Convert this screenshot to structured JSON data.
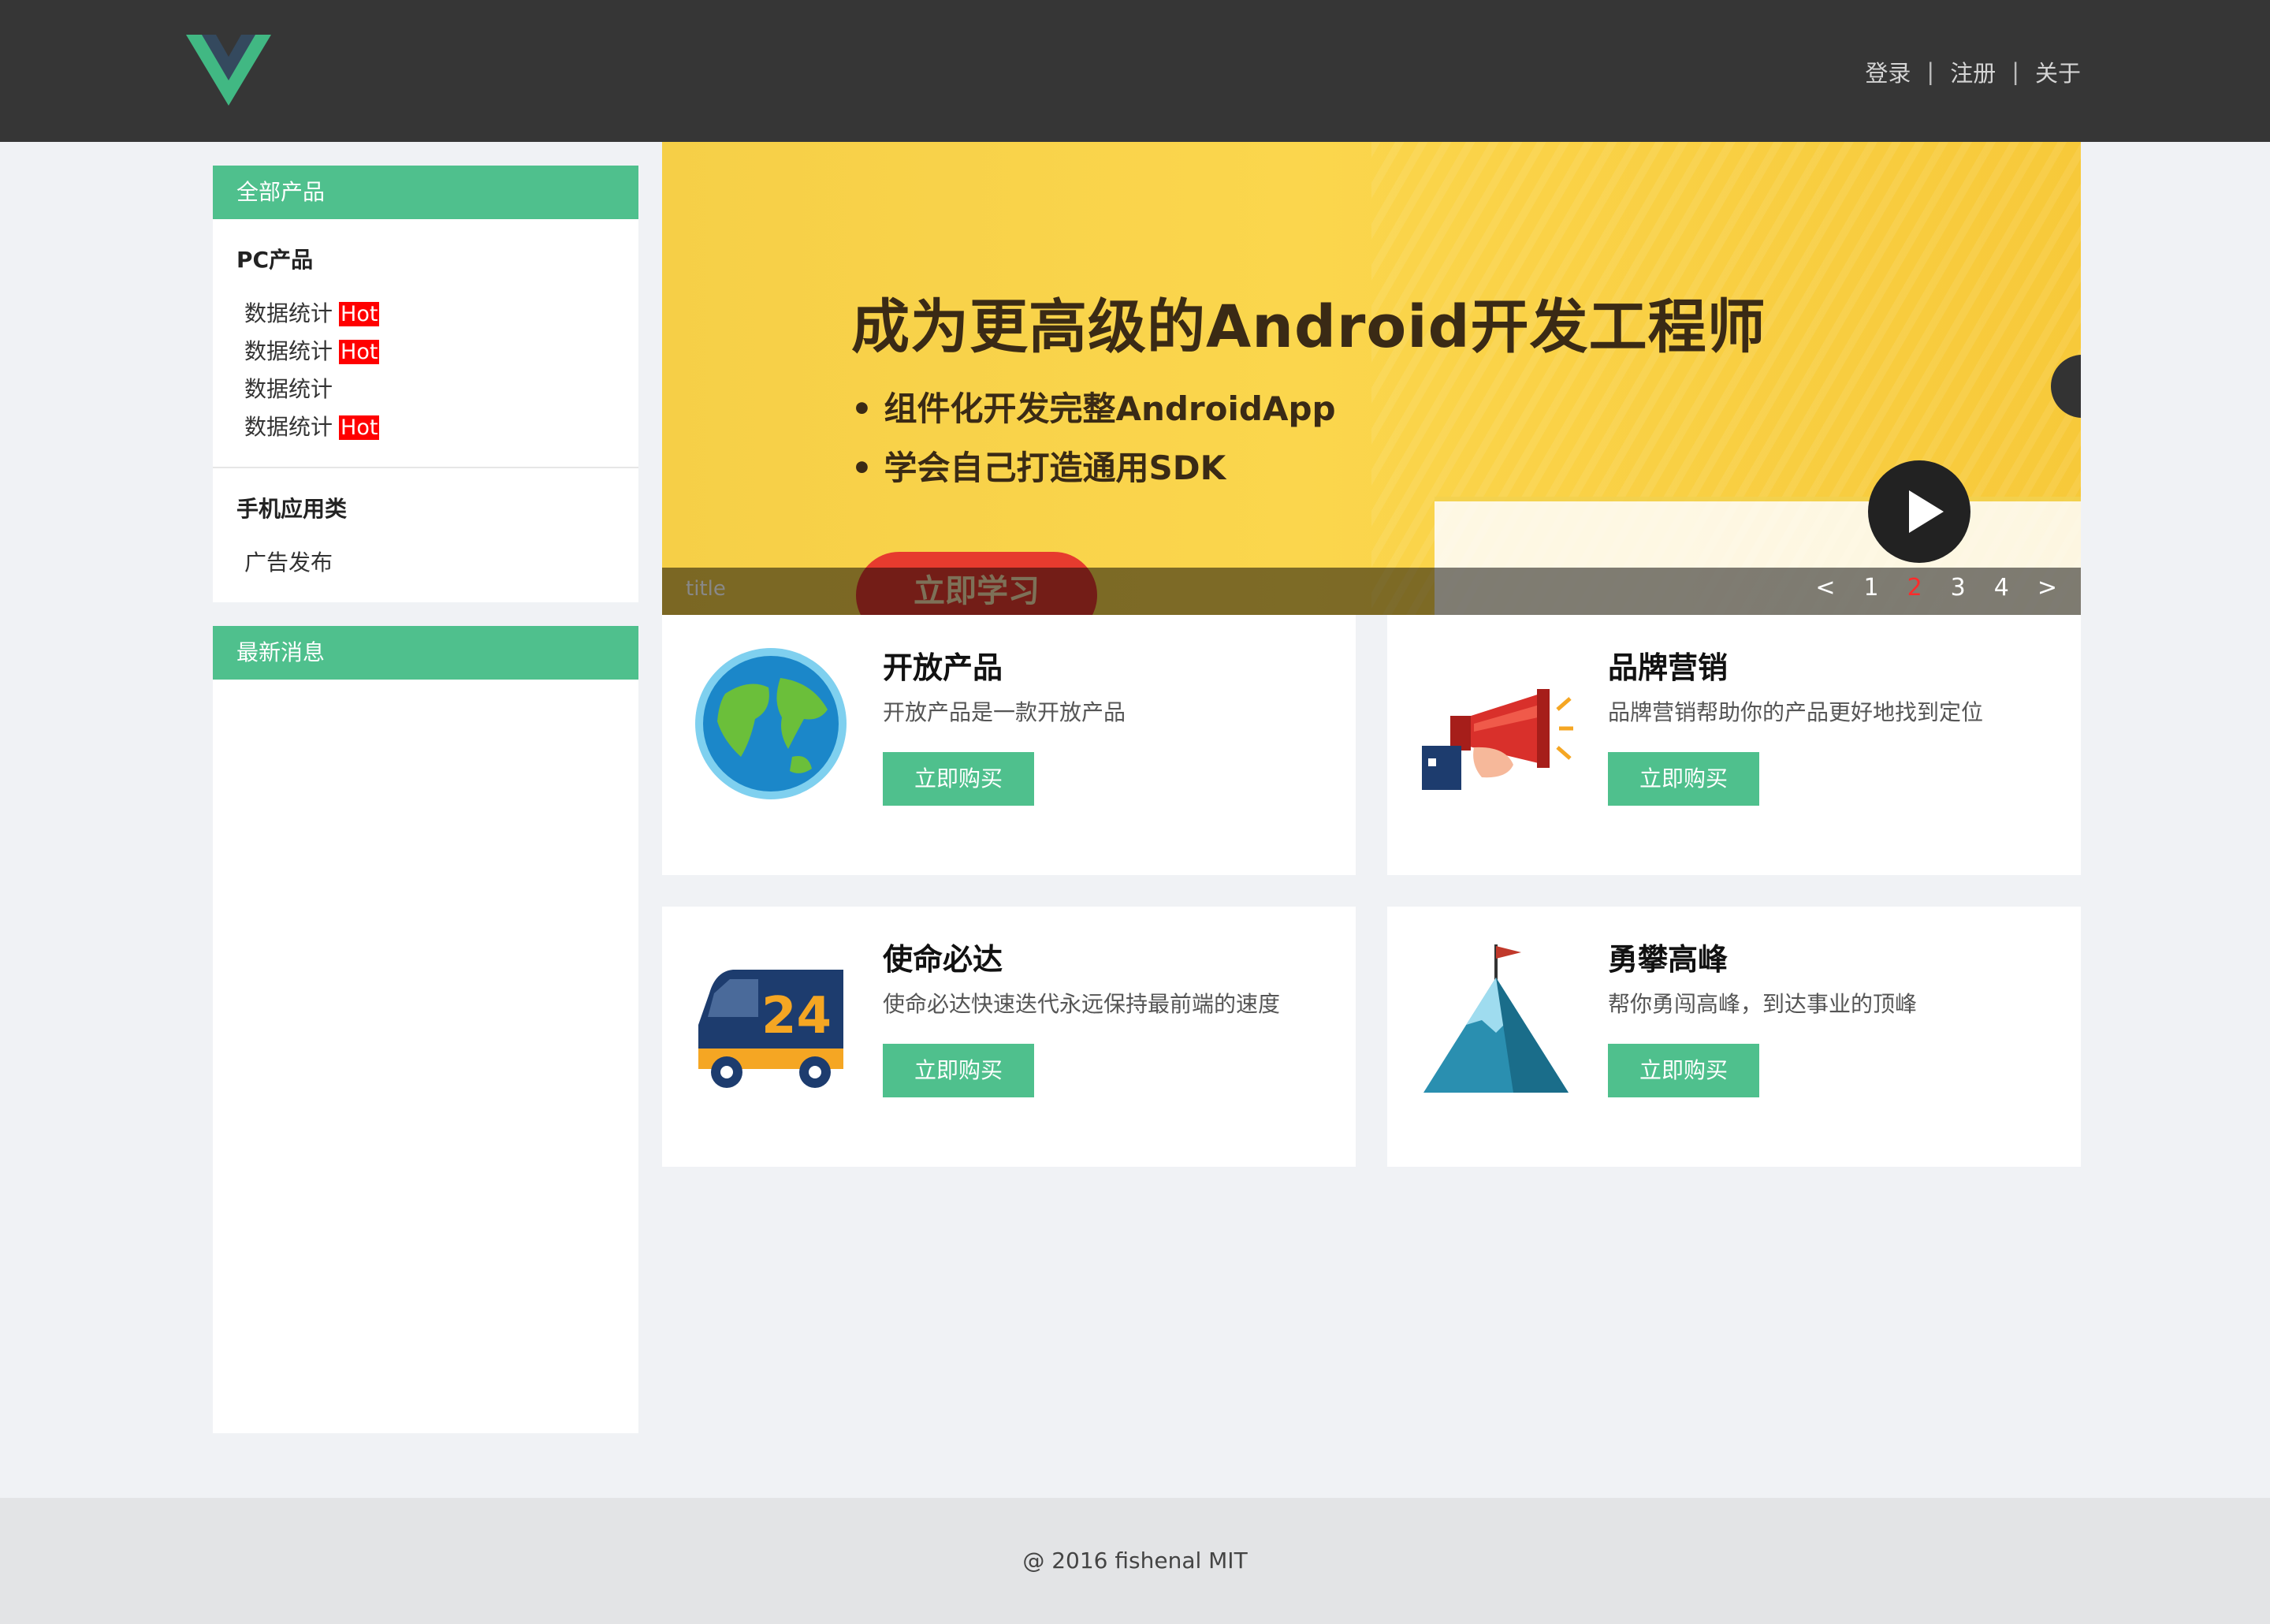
{
  "header": {
    "nav": [
      "登录",
      "注册",
      "关于"
    ],
    "separator": "|"
  },
  "sidebar": {
    "products_title": "全部产品",
    "groups": [
      {
        "title": "PC产品",
        "items": [
          {
            "label": "数据统计",
            "badge": "Hot"
          },
          {
            "label": "数据统计",
            "badge": "Hot"
          },
          {
            "label": "数据统计",
            "badge": ""
          },
          {
            "label": "数据统计",
            "badge": "Hot"
          }
        ]
      },
      {
        "title": "手机应用类",
        "items": [
          {
            "label": "广告发布",
            "badge": ""
          }
        ]
      }
    ],
    "news_title": "最新消息"
  },
  "slider": {
    "headline": "成为更高级的Android开发工程师",
    "bullet_1": "• 组件化开发完整AndroidApp",
    "bullet_2": "• 学会自己打造通用SDK",
    "cta": "立即学习",
    "caption": "title",
    "prev": "<",
    "next": ">",
    "pages": [
      "1",
      "2",
      "3",
      "4"
    ],
    "active_page": "2"
  },
  "cards": [
    {
      "title": "开放产品",
      "desc": "开放产品是一款开放产品",
      "button": "立即购买",
      "icon": "globe-icon"
    },
    {
      "title": "品牌营销",
      "desc": "品牌营销帮助你的产品更好地找到定位",
      "button": "立即购买",
      "icon": "megaphone-icon"
    },
    {
      "title": "使命必达",
      "desc": "使命必达快速迭代永远保持最前端的速度",
      "button": "立即购买",
      "icon": "truck-icon"
    },
    {
      "title": "勇攀高峰",
      "desc": "帮你勇闯高峰，到达事业的顶峰",
      "button": "立即购买",
      "icon": "mountain-icon"
    }
  ],
  "footer": {
    "text": "@ 2016 fishenal MIT"
  },
  "colors": {
    "accent": "#4fc08d",
    "header_bg": "#363636",
    "hot_badge": "#ff0000"
  }
}
